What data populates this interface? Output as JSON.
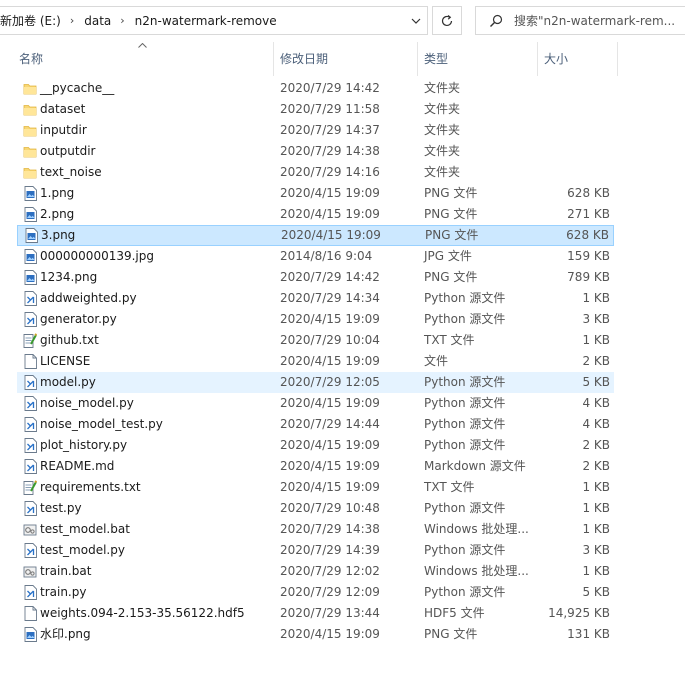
{
  "address": {
    "crumbs": [
      "新加卷 (E:)",
      "data",
      "n2n-watermark-remove"
    ]
  },
  "search": {
    "placeholder": "搜索\"n2n-watermark-rem..."
  },
  "columns": {
    "name": "名称",
    "date": "修改日期",
    "type": "类型",
    "size": "大小"
  },
  "files": [
    {
      "name": "__pycache__",
      "date": "2020/7/29 14:42",
      "type": "文件夹",
      "size": "",
      "icon": "folder-icon"
    },
    {
      "name": "dataset",
      "date": "2020/7/29 11:58",
      "type": "文件夹",
      "size": "",
      "icon": "folder-icon"
    },
    {
      "name": "inputdir",
      "date": "2020/7/29 14:37",
      "type": "文件夹",
      "size": "",
      "icon": "folder-icon"
    },
    {
      "name": "outputdir",
      "date": "2020/7/29 14:38",
      "type": "文件夹",
      "size": "",
      "icon": "folder-icon"
    },
    {
      "name": "text_noise",
      "date": "2020/7/29 14:16",
      "type": "文件夹",
      "size": "",
      "icon": "folder-icon"
    },
    {
      "name": "1.png",
      "date": "2020/4/15 19:09",
      "type": "PNG 文件",
      "size": "628 KB",
      "icon": "image-file-icon"
    },
    {
      "name": "2.png",
      "date": "2020/4/15 19:09",
      "type": "PNG 文件",
      "size": "271 KB",
      "icon": "image-file-icon"
    },
    {
      "name": "3.png",
      "date": "2020/4/15 19:09",
      "type": "PNG 文件",
      "size": "628 KB",
      "icon": "image-file-icon",
      "state": "selected"
    },
    {
      "name": "000000000139.jpg",
      "date": "2014/8/16 9:04",
      "type": "JPG 文件",
      "size": "159 KB",
      "icon": "image-file-icon"
    },
    {
      "name": "1234.png",
      "date": "2020/7/29 14:42",
      "type": "PNG 文件",
      "size": "789 KB",
      "icon": "image-file-icon"
    },
    {
      "name": "addweighted.py",
      "date": "2020/7/29 14:34",
      "type": "Python 源文件",
      "size": "1 KB",
      "icon": "python-file-icon"
    },
    {
      "name": "generator.py",
      "date": "2020/4/15 19:09",
      "type": "Python 源文件",
      "size": "3 KB",
      "icon": "python-file-icon"
    },
    {
      "name": "github.txt",
      "date": "2020/7/29 10:04",
      "type": "TXT 文件",
      "size": "1 KB",
      "icon": "text-file-icon"
    },
    {
      "name": "LICENSE",
      "date": "2020/4/15 19:09",
      "type": "文件",
      "size": "2 KB",
      "icon": "blank-file-icon"
    },
    {
      "name": "model.py",
      "date": "2020/7/29 12:05",
      "type": "Python 源文件",
      "size": "5 KB",
      "icon": "python-file-icon",
      "state": "hover"
    },
    {
      "name": "noise_model.py",
      "date": "2020/4/15 19:09",
      "type": "Python 源文件",
      "size": "4 KB",
      "icon": "python-file-icon"
    },
    {
      "name": "noise_model_test.py",
      "date": "2020/7/29 14:44",
      "type": "Python 源文件",
      "size": "4 KB",
      "icon": "python-file-icon"
    },
    {
      "name": "plot_history.py",
      "date": "2020/4/15 19:09",
      "type": "Python 源文件",
      "size": "2 KB",
      "icon": "python-file-icon"
    },
    {
      "name": "README.md",
      "date": "2020/4/15 19:09",
      "type": "Markdown 源文件",
      "size": "2 KB",
      "icon": "python-file-icon"
    },
    {
      "name": "requirements.txt",
      "date": "2020/4/15 19:09",
      "type": "TXT 文件",
      "size": "1 KB",
      "icon": "text-file-icon"
    },
    {
      "name": "test.py",
      "date": "2020/7/29 10:48",
      "type": "Python 源文件",
      "size": "1 KB",
      "icon": "python-file-icon"
    },
    {
      "name": "test_model.bat",
      "date": "2020/7/29 14:38",
      "type": "Windows 批处理...",
      "size": "1 KB",
      "icon": "batch-file-icon"
    },
    {
      "name": "test_model.py",
      "date": "2020/7/29 14:39",
      "type": "Python 源文件",
      "size": "3 KB",
      "icon": "python-file-icon"
    },
    {
      "name": "train.bat",
      "date": "2020/7/29 12:02",
      "type": "Windows 批处理...",
      "size": "1 KB",
      "icon": "batch-file-icon"
    },
    {
      "name": "train.py",
      "date": "2020/7/29 12:09",
      "type": "Python 源文件",
      "size": "5 KB",
      "icon": "python-file-icon"
    },
    {
      "name": "weights.094-2.153-35.56122.hdf5",
      "date": "2020/7/29 13:44",
      "type": "HDF5 文件",
      "size": "14,925 KB",
      "icon": "blank-file-icon"
    },
    {
      "name": "水印.png",
      "date": "2020/4/15 19:09",
      "type": "PNG 文件",
      "size": "131 KB",
      "icon": "image-file-icon"
    }
  ]
}
